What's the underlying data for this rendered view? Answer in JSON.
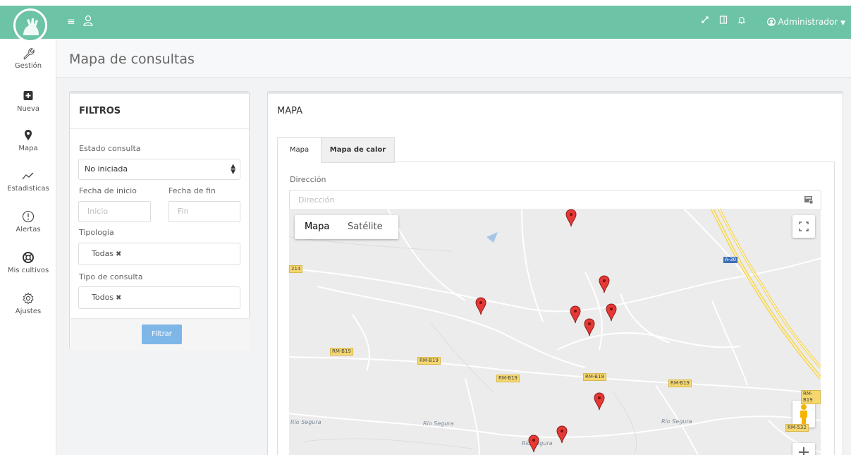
{
  "topbar": {
    "menu_icon": "hamburger-icon",
    "user_icon": "user-icon",
    "expand_icon": "expand-icon",
    "panel_icon": "panel-icon",
    "bell_icon": "bell-icon",
    "admin_label": "Administrador"
  },
  "sidebar": {
    "items": [
      {
        "label": "Gestión",
        "icon": "wrench-icon"
      },
      {
        "label": "Nueva",
        "icon": "plus-square-icon"
      },
      {
        "label": "Mapa",
        "icon": "map-marker-icon"
      },
      {
        "label": "Estadisticas",
        "icon": "line-chart-icon"
      },
      {
        "label": "Alertas",
        "icon": "alert-circle-icon"
      },
      {
        "label": "Mis cultivos",
        "icon": "life-ring-icon"
      },
      {
        "label": "Ajustes",
        "icon": "gear-icon"
      }
    ]
  },
  "page": {
    "title": "Mapa de consultas"
  },
  "filtros": {
    "title": "FILTROS",
    "estado_label": "Estado consulta",
    "estado_value": "No iniciada",
    "fecha_inicio_label": "Fecha de inicio",
    "fecha_inicio_placeholder": "Inicio",
    "fecha_fin_label": "Fecha de fin",
    "fecha_fin_placeholder": "Fin",
    "tipologia_label": "Tipologia",
    "tipologia_tag": "Todas",
    "tipo_label": "Tipo de consulta",
    "tipo_tag": "Todos",
    "button": "Filtrar"
  },
  "mapa": {
    "title": "MAPA",
    "tabs": [
      {
        "label": "Mapa",
        "active": true
      },
      {
        "label": "Mapa de calor",
        "active": false
      }
    ],
    "direccion_label": "Dirección",
    "direccion_placeholder": "Dirección",
    "map_type_options": [
      "Mapa",
      "Satélite"
    ],
    "road_labels": [
      "RM-B19",
      "RM-B19",
      "RM-B19",
      "RM-B19",
      "RM-B19",
      "RM-B19",
      "RM-532"
    ],
    "highway_label": "A-30",
    "edge_label": "214",
    "river_labels": [
      "Río Segura",
      "Río Segura",
      "Río Segura",
      "Río Segura"
    ],
    "pin_color": "#e53935"
  },
  "colors": {
    "brand_green": "#6cc3a6",
    "button_blue": "#7fb6e8"
  }
}
